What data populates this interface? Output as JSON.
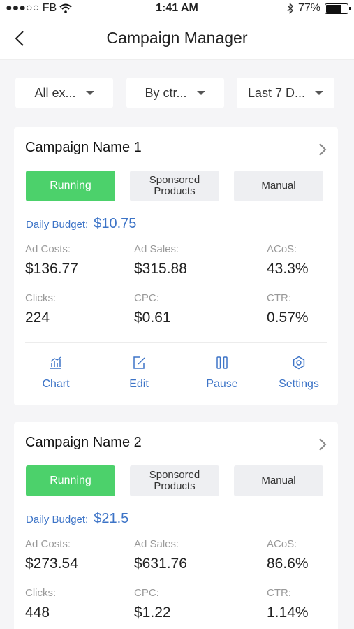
{
  "status_bar": {
    "carrier": "●●●○○ FB",
    "time": "1:41 AM",
    "battery": "77%",
    "battery_level": 0.77
  },
  "nav": {
    "title": "Campaign Manager"
  },
  "filters": [
    {
      "label": "All ex..."
    },
    {
      "label": "By ctr..."
    },
    {
      "label": "Last 7 D..."
    }
  ],
  "campaigns": [
    {
      "name": "Campaign Name 1",
      "status": "Running",
      "type": "Sponsored Products",
      "targeting": "Manual",
      "budget_label": "Daily Budget:",
      "budget": "$10.75",
      "ad_costs_label": "Ad Costs:",
      "ad_costs": "$136.77",
      "ad_sales_label": "Ad Sales:",
      "ad_sales": "$315.88",
      "acos_label": "ACoS:",
      "acos": "43.3%",
      "clicks_label": "Clicks:",
      "clicks": "224",
      "cpc_label": "CPC:",
      "cpc": "$0.61",
      "ctr_label": "CTR:",
      "ctr": "0.57%"
    },
    {
      "name": "Campaign Name 2",
      "status": "Running",
      "type": "Sponsored Products",
      "targeting": "Manual",
      "budget_label": "Daily Budget:",
      "budget": "$21.5",
      "ad_costs_label": "Ad Costs:",
      "ad_costs": "$273.54",
      "ad_sales_label": "Ad Sales:",
      "ad_sales": "$631.76",
      "acos_label": "ACoS:",
      "acos": "86.6%",
      "clicks_label": "Clicks:",
      "clicks": "448",
      "cpc_label": "CPC:",
      "cpc": "$1.22",
      "ctr_label": "CTR:",
      "ctr": "1.14%"
    }
  ],
  "actions": {
    "chart": "Chart",
    "edit": "Edit",
    "pause": "Pause",
    "settings": "Settings"
  },
  "icons": {
    "back": "chevron-left-icon",
    "chevron": "chevron-right-icon",
    "chart": "bar-chart-icon",
    "edit": "edit-icon",
    "pause": "pause-icon",
    "settings": "gear-icon",
    "wifi": "wifi-icon",
    "bluetooth": "bluetooth-icon"
  },
  "colors": {
    "accent": "#3d74c7",
    "running": "#4cd16b",
    "tag_bg": "#eeeff2"
  }
}
